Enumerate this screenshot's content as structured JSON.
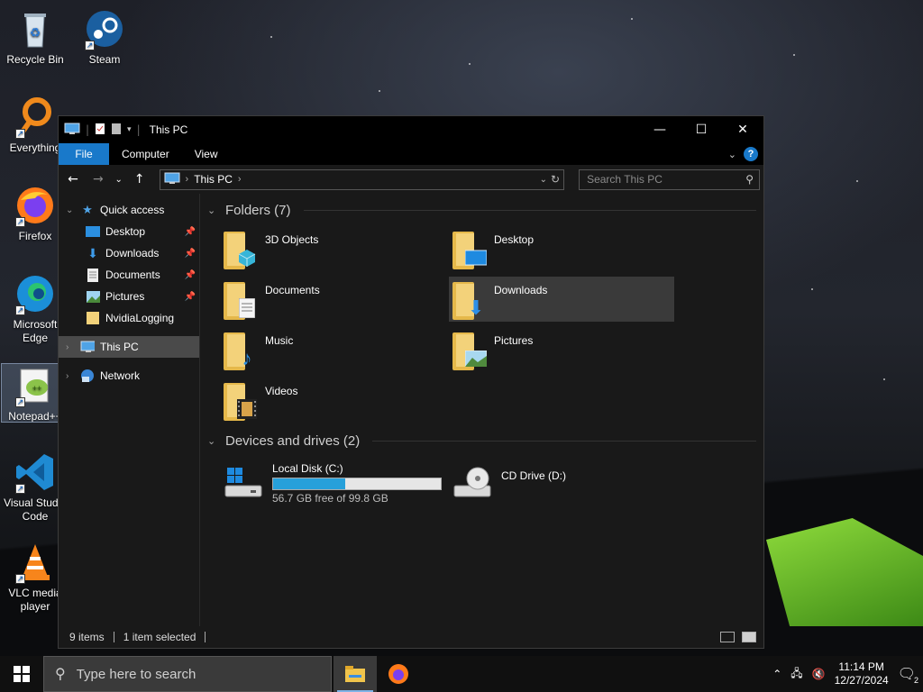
{
  "desktop": {
    "icons": [
      {
        "label": "Recycle Bin",
        "icon": "recycle-bin-icon"
      },
      {
        "label": "Steam",
        "icon": "steam-icon"
      },
      {
        "label": "Everything",
        "icon": "everything-icon"
      },
      {
        "label": "Firefox",
        "icon": "firefox-icon"
      },
      {
        "label": "Microsoft Edge",
        "icon": "edge-icon"
      },
      {
        "label": "Notepad++",
        "icon": "notepadpp-icon"
      },
      {
        "label": "Visual Studio Code",
        "icon": "vscode-icon"
      },
      {
        "label": "VLC media player",
        "icon": "vlc-icon"
      }
    ]
  },
  "explorer": {
    "title": "This PC",
    "ribbon_tabs": [
      "File",
      "Computer",
      "View"
    ],
    "address": {
      "location": "This PC",
      "search_placeholder": "Search This PC"
    },
    "nav": {
      "quick_access": "Quick access",
      "quick_items": [
        "Desktop",
        "Downloads",
        "Documents",
        "Pictures",
        "NvidiaLogging"
      ],
      "this_pc": "This PC",
      "network": "Network"
    },
    "folders_header": "Folders (7)",
    "folders": [
      "3D Objects",
      "Desktop",
      "Documents",
      "Downloads",
      "Music",
      "Pictures",
      "Videos"
    ],
    "drives_header": "Devices and drives (2)",
    "drives": [
      {
        "name": "Local Disk (C:)",
        "free": "56.7 GB free of 99.8 GB",
        "used_fraction": 0.43
      },
      {
        "name": "CD Drive (D:)"
      }
    ],
    "status": {
      "items": "9 items",
      "selected": "1 item selected"
    }
  },
  "taskbar": {
    "search_placeholder": "Type here to search",
    "time": "11:14 PM",
    "date": "12/27/2024",
    "notifications": "2"
  },
  "colors": {
    "accent": "#1979ca",
    "disk_bar": "#26a0da",
    "folder": "#e5b84a"
  }
}
